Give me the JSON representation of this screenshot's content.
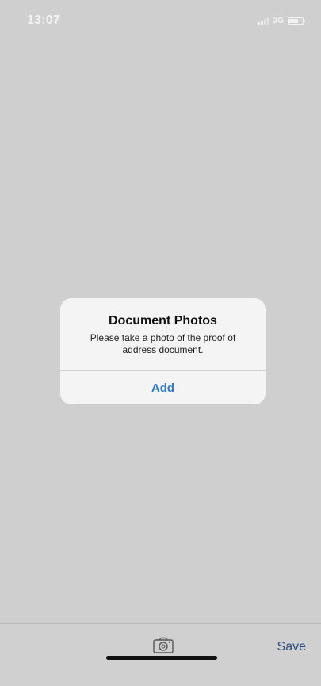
{
  "status_bar": {
    "time": "13:07",
    "network": "3G",
    "battery_level": 0.7
  },
  "dialog": {
    "title": "Document Photos",
    "message": "Please take a photo of the proof of address document.",
    "action_label": "Add",
    "accent_color": "#2d7dd2"
  },
  "toolbar": {
    "camera_icon": "camera-icon",
    "save_label": "Save",
    "save_color": "#2b4f86"
  },
  "colors": {
    "background": "#cfcfcf",
    "dialog_background": "#f6f6f6"
  }
}
